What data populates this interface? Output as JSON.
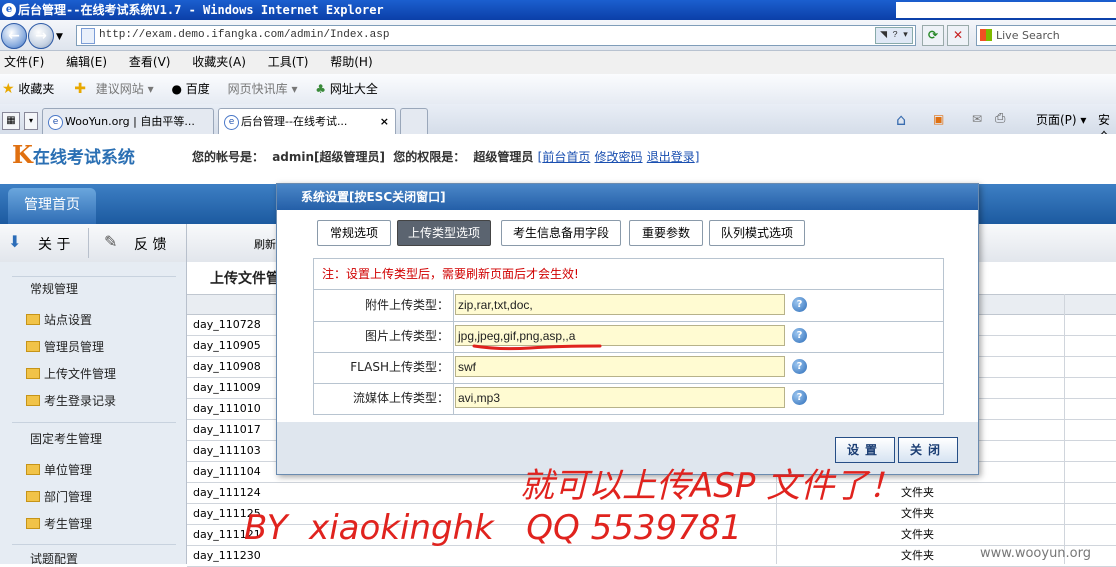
{
  "window": {
    "title": "后台管理--在线考试系统V1.7 - Windows Internet Explorer"
  },
  "browser": {
    "url": "http://exam.demo.ifangka.com/admin/Index.asp",
    "search_placeholder": "Live Search",
    "menu": [
      "文件(F)",
      "编辑(E)",
      "查看(V)",
      "收藏夹(A)",
      "工具(T)",
      "帮助(H)"
    ],
    "favorites": {
      "label": "收藏夹",
      "items": [
        "建议网站 ▾",
        "百度",
        "网页快讯库 ▾",
        "网址大全"
      ]
    },
    "tabs": [
      {
        "label": "WooYun.org | 自由平等..."
      },
      {
        "label": "后台管理--在线考试..."
      }
    ],
    "tab_close": "×",
    "cmdbar": {
      "page": "页面(P) ▾",
      "safety": "安全"
    }
  },
  "app": {
    "brand_letter": "K",
    "brand": "在线考试系统",
    "account": {
      "label1": "您的帐号是：",
      "user": "admin[超级管理员]",
      "label2": "您的权限是：",
      "role": "超级管理员",
      "links": [
        "前台首页",
        "修改密码",
        "退出登录"
      ]
    },
    "nav_tab": "管理首页",
    "toolbar": {
      "about": "关 于",
      "feedback": "反 馈",
      "refresh": "刷新"
    },
    "page_title": "上传文件管",
    "sidebar": {
      "group1": "常规管理",
      "items1": [
        "站点设置",
        "管理员管理",
        "上传文件管理",
        "考生登录记录"
      ],
      "group2": "固定考生管理",
      "items2": [
        "单位管理",
        "部门管理",
        "考生管理"
      ],
      "group3": "试题配置"
    },
    "files": [
      {
        "name": "day_110728",
        "type": ""
      },
      {
        "name": "day_110905",
        "type": ""
      },
      {
        "name": "day_110908",
        "type": ""
      },
      {
        "name": "day_111009",
        "type": ""
      },
      {
        "name": "day_111010",
        "type": ""
      },
      {
        "name": "day_111017",
        "type": ""
      },
      {
        "name": "day_111103",
        "type": ""
      },
      {
        "name": "day_111104",
        "type": ""
      },
      {
        "name": "day_111124",
        "type": "文件夹"
      },
      {
        "name": "day_111125",
        "type": "文件夹"
      },
      {
        "name": "day_111121",
        "type": "文件夹"
      },
      {
        "name": "day_111230",
        "type": "文件夹"
      }
    ]
  },
  "modal": {
    "title": "系统设置[按ESC关闭窗口]",
    "tabs": [
      "常规选项",
      "上传类型选项",
      "考生信息备用字段",
      "重要参数",
      "队列模式选项"
    ],
    "active_tab": "上传类型选项",
    "note": "注：设置上传类型后，需要刷新页面后才会生效!",
    "fields": [
      {
        "label": "附件上传类型：",
        "value": "zip,rar,txt,doc,"
      },
      {
        "label": "图片上传类型：",
        "value": "jpg,jpeg,gif,png,asp,,a"
      },
      {
        "label": "FLASH上传类型：",
        "value": "swf"
      },
      {
        "label": "流媒体上传类型：",
        "value": "avi,mp3"
      }
    ],
    "help": "?",
    "buttons": {
      "save": "设置",
      "close": "关闭"
    }
  },
  "annotations": {
    "line1": "就可以上传ASP 文件了！",
    "line2": "BY  xiaokinghk   QQ 5539781",
    "color": "#e0231e"
  },
  "watermark": "www.wooyun.org"
}
